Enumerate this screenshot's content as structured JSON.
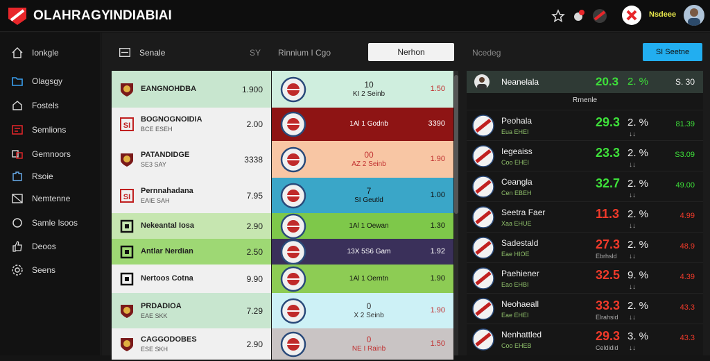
{
  "header": {
    "brand": "OLAHRAGY",
    "title": "INDIABIAI",
    "user": "Nsdeee",
    "accent_color": "#e8262a"
  },
  "sidebar": {
    "items": [
      {
        "label": "Ionkgle",
        "icon": "home-icon"
      },
      {
        "label": "Olagsgy",
        "icon": "folder-icon"
      },
      {
        "label": "Fostels",
        "icon": "house-icon"
      },
      {
        "label": "Semlions",
        "icon": "grid-icon"
      },
      {
        "label": "Gemnoors",
        "icon": "link-icon"
      },
      {
        "label": "Rsoie",
        "icon": "puzzle-icon"
      },
      {
        "label": "Nemtenne",
        "icon": "flag-icon"
      },
      {
        "label": "Samle Isoos",
        "icon": "circle-icon"
      },
      {
        "label": "Deoos",
        "icon": "thumb-icon"
      },
      {
        "label": "Seens",
        "icon": "gear-icon"
      }
    ]
  },
  "toolbar": {
    "menu_label": "Senale",
    "filter_a": "SY",
    "filter_b": "Rinnium I Cgo",
    "active_button": "Nerhon",
    "filter_c": "Ncedeg",
    "cta_button": "SI Seetne"
  },
  "left_rows": [
    {
      "name": "EANGNOHDBA",
      "sub": "",
      "value": "1.900",
      "bg": "#c8e6cf",
      "badge": "crest-icon"
    },
    {
      "name": "BOGNOGNOIDIA",
      "sub": "BCE ESEH",
      "value": "2.00",
      "bg": "#f0f0f0",
      "badge": "shield-icon"
    },
    {
      "name": "PATANDIDGE",
      "sub": "SE3 SAY",
      "value": "3338",
      "bg": "#f0f0f0",
      "badge": "crest-icon"
    },
    {
      "name": "Pernnahadana",
      "sub": "EAIE SAH",
      "value": "7.95",
      "bg": "#f0f0f0",
      "badge": "shield-icon"
    },
    {
      "name": "Nekeantal Iosa",
      "sub": "",
      "value": "2.90",
      "bg": "#c6e6b0",
      "badge": "square-icon"
    },
    {
      "name": "Antlar Nerdian",
      "sub": "",
      "value": "2.50",
      "bg": "#9ed874",
      "badge": "square-icon"
    },
    {
      "name": "Nertoos Cotna",
      "sub": "",
      "value": "9.90",
      "bg": "#f0f0f0",
      "badge": "square-icon"
    },
    {
      "name": "PRDADIOA",
      "sub": "EAE SKK",
      "value": "7.29",
      "bg": "#c8e6cf",
      "badge": "crest-icon"
    },
    {
      "name": "CAGGODOBES",
      "sub": "ESE SKH",
      "value": "2.90",
      "bg": "#f0f0f0",
      "badge": "crest-icon"
    }
  ],
  "mid_rows": [
    {
      "num": "10",
      "label": "KI 2 Seinb",
      "value": "1.50",
      "bg": "#cfeede",
      "color": "#222",
      "valcolor": "#c03030"
    },
    {
      "num": "",
      "label": "1Al 1 Godnb",
      "value": "3390",
      "bg": "#8e1414",
      "color": "#fff",
      "valcolor": "#fff"
    },
    {
      "num": "00",
      "label": "AZ 2 Seinb",
      "value": "1.90",
      "bg": "#f8c6a4",
      "color": "#c03030",
      "valcolor": "#c03030"
    },
    {
      "num": "7",
      "label": "SI Geutld",
      "value": "1.00",
      "bg": "#3aa6c8",
      "color": "#111",
      "valcolor": "#111"
    },
    {
      "num": "",
      "label": "1Al 1 Oewan",
      "value": "1.30",
      "bg": "#7ec84a",
      "color": "#111",
      "valcolor": "#111"
    },
    {
      "num": "",
      "label": "13X 5S6 Gam",
      "value": "1.92",
      "bg": "#3a305a",
      "color": "#fff",
      "valcolor": "#fff"
    },
    {
      "num": "",
      "label": "1Al 1 Oerntn",
      "value": "1.90",
      "bg": "#8dcc54",
      "color": "#111",
      "valcolor": "#111"
    },
    {
      "num": "0",
      "label": "X 2 Seinb",
      "value": "1.90",
      "bg": "#cdf1f6",
      "color": "#333",
      "valcolor": "#c03030"
    },
    {
      "num": "0",
      "label": "NE I Rainb",
      "value": "1.50",
      "bg": "#c9c4c4",
      "color": "#c03030",
      "valcolor": "#c03030"
    }
  ],
  "right_panel": {
    "header_name": "Neanelala",
    "header_value": "20.3",
    "header_pct": "2. %",
    "header_right": "S. 30",
    "subheader": "Rrnenle",
    "rows": [
      {
        "name": "Peohala",
        "sub": "Eua EHEI",
        "value": "29.3",
        "vsub": "",
        "pct": "2. %",
        "arr": "↓↓",
        "right": "81.39",
        "vcolor": "green",
        "rcolor": "green"
      },
      {
        "name": "Iegeaiss",
        "sub": "Coo EHEI",
        "value": "23.3",
        "vsub": "",
        "pct": "2. %",
        "arr": "↓↓",
        "right": "S3.09",
        "vcolor": "green",
        "rcolor": "green"
      },
      {
        "name": "Ceangla",
        "sub": "Cen EBEH",
        "value": "32.7",
        "vsub": "",
        "pct": "2. %",
        "arr": "↓↓",
        "right": "49.00",
        "vcolor": "green",
        "rcolor": "green"
      },
      {
        "name": "Seetra Faer",
        "sub": "Xaa EHUE",
        "value": "11.3",
        "vsub": "",
        "pct": "2. %",
        "arr": "↓↓",
        "right": "4.99",
        "vcolor": "red",
        "rcolor": "red"
      },
      {
        "name": "Sadestald",
        "sub": "Eae HIOE",
        "value": "27.3",
        "vsub": "Ebrhsld",
        "pct": "2. %",
        "arr": "↓↓",
        "right": "48.9",
        "vcolor": "red",
        "rcolor": "red"
      },
      {
        "name": "Paehiener",
        "sub": "Eao EHBI",
        "value": "32.5",
        "vsub": "",
        "pct": "9. %",
        "arr": "↓↓",
        "right": "4.39",
        "vcolor": "red",
        "rcolor": "red"
      },
      {
        "name": "Neohaeall",
        "sub": "Eae EHEI",
        "value": "33.3",
        "vsub": "Elrahsid",
        "pct": "2. %",
        "arr": "↓↓",
        "right": "43.3",
        "vcolor": "red",
        "rcolor": "red"
      },
      {
        "name": "Nenhattled",
        "sub": "Coo EHEB",
        "value": "29.3",
        "vsub": "Celdidid",
        "pct": "3. %",
        "arr": "↓↓",
        "right": "43.3",
        "vcolor": "red",
        "rcolor": "red"
      }
    ]
  }
}
